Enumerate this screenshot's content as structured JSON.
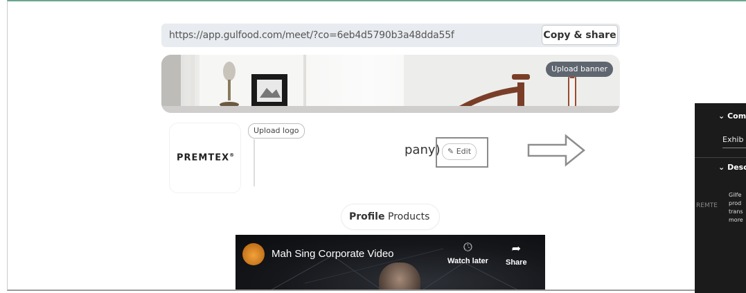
{
  "url_bar": {
    "url": "https://app.gulfood.com/meet/?co=6eb4d5790b3a48dda55f",
    "copy_label": "Copy & share"
  },
  "banner": {
    "upload_label": "Upload banner"
  },
  "company": {
    "logo_text": "PREMTEX",
    "logo_mark": "®",
    "upload_logo_label": "Upload logo",
    "name_suffix": "pany)",
    "edit_label": "Edit"
  },
  "tabs": [
    {
      "label": "Profile",
      "active": true
    },
    {
      "label": "Products",
      "active": false
    }
  ],
  "video": {
    "title": "Mah Sing Corporate Video",
    "watch_later_label": "Watch later",
    "share_label": "Share"
  },
  "side_panel": {
    "section1": "Com",
    "sub1": "Exhib",
    "section2": "Desc",
    "lines": [
      "Gilfe",
      "prod",
      "trans",
      "more"
    ],
    "logo_fragment": "REMTE"
  },
  "colors": {
    "frame_top": "#6aa78c",
    "url_bar_bg": "#e8ebef",
    "upload_banner_bg": "#5f6670",
    "panel_bg": "#1b1b1b"
  }
}
